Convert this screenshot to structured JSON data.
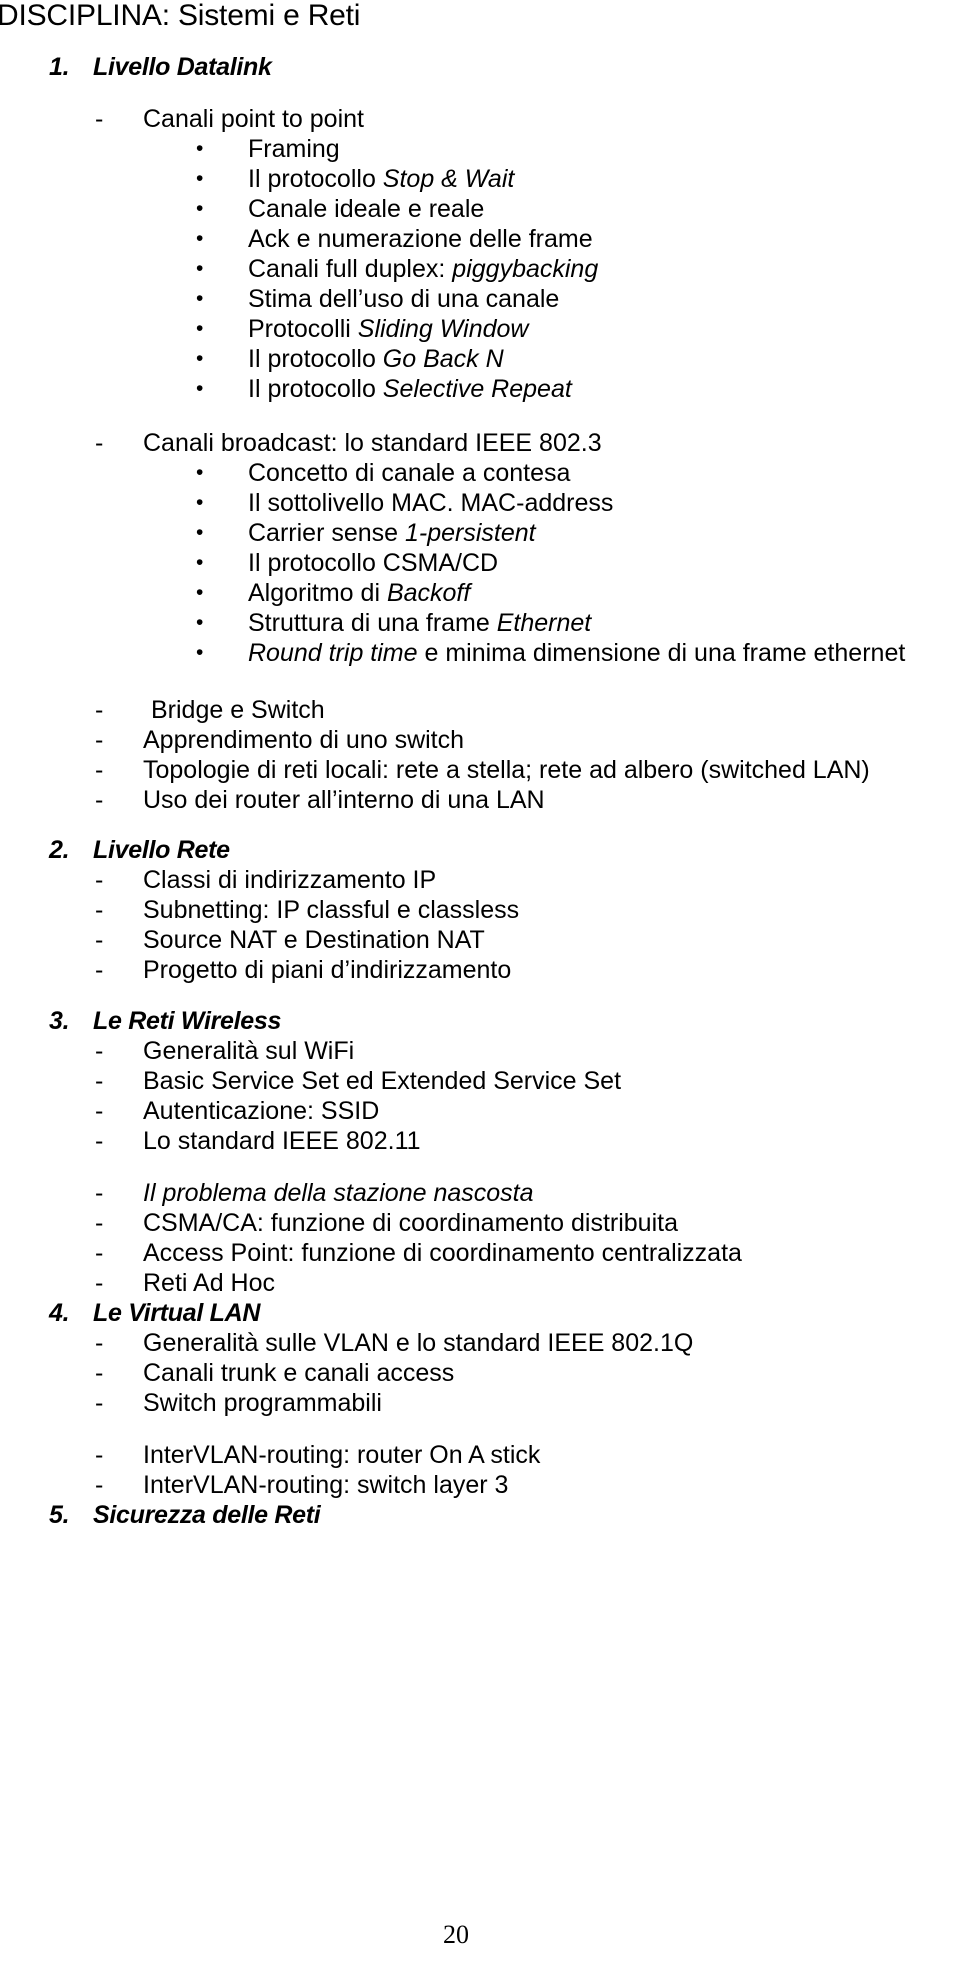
{
  "document": {
    "title": "DISCIPLINA: Sistemi e Reti",
    "page_number": "20",
    "bullet_glyph": "•",
    "dash_glyph": "-"
  },
  "sections": [
    {
      "number": "1.",
      "heading": "Livello Datalink",
      "items": [
        {
          "level": "dash",
          "text": "Canali point to point",
          "children": [
            {
              "level": "bullet",
              "text": "Framing"
            },
            {
              "level": "bullet",
              "pre": "Il protocollo ",
              "italic": "Stop & Wait",
              "post": ""
            },
            {
              "level": "bullet",
              "text": "Canale ideale e reale"
            },
            {
              "level": "bullet",
              "text": "Ack e numerazione delle frame"
            },
            {
              "level": "bullet",
              "pre": "Canali full duplex: ",
              "italic": "piggybacking",
              "post": ""
            },
            {
              "level": "bullet",
              "text": "Stima dell’uso di una canale"
            },
            {
              "level": "bullet",
              "pre": "Protocolli ",
              "italic": "Sliding Window",
              "post": ""
            },
            {
              "level": "bullet",
              "pre": "Il protocollo ",
              "italic": "Go Back N",
              "post": ""
            },
            {
              "level": "bullet",
              "pre": "Il protocollo ",
              "italic": "Selective Repeat",
              "post": ""
            }
          ]
        },
        {
          "level": "dash",
          "text": "Canali broadcast: lo standard IEEE 802.3",
          "children": [
            {
              "level": "bullet",
              "text": "Concetto di canale a contesa"
            },
            {
              "level": "bullet",
              "text": "Il sottolivello MAC.  MAC-address"
            },
            {
              "level": "bullet",
              "pre": "Carrier sense ",
              "italic": "1-persistent",
              "post": ""
            },
            {
              "level": "bullet",
              "text": "Il protocollo CSMA/CD"
            },
            {
              "level": "bullet",
              "pre": "Algoritmo di ",
              "italic": "Backoff",
              "post": ""
            },
            {
              "level": "bullet",
              "pre": "Struttura di una frame ",
              "italic": "Ethernet",
              "post": ""
            },
            {
              "level": "bullet",
              "pre": "",
              "italic": "Round trip time",
              "post": " e minima dimensione di una frame ethernet"
            }
          ]
        },
        {
          "level": "dash",
          "text": "Bridge e Switch",
          "extra_indent": true
        },
        {
          "level": "dash",
          "text": "Apprendimento di uno switch"
        },
        {
          "level": "dash",
          "text": "Topologie di reti locali: rete a stella; rete ad albero (switched LAN)"
        },
        {
          "level": "dash",
          "text": "Uso dei router all’interno di una LAN"
        }
      ]
    },
    {
      "number": "2.",
      "heading": "Livello Rete",
      "items": [
        {
          "level": "dash",
          "text": "Classi di indirizzamento IP"
        },
        {
          "level": "dash",
          "text": "Subnetting: IP classful e classless"
        },
        {
          "level": "dash",
          "text": "Source NAT e  Destination NAT"
        },
        {
          "level": "dash",
          "text": "Progetto di piani d’indirizzamento"
        }
      ]
    },
    {
      "number": "3.",
      "heading": "Le Reti Wireless",
      "items": [
        {
          "level": "dash",
          "text": "Generalità sul WiFi"
        },
        {
          "level": "dash",
          "text": "Basic Service Set ed Extended Service Set"
        },
        {
          "level": "dash",
          "text": "Autenticazione: SSID"
        },
        {
          "level": "dash",
          "text": "Lo standard IEEE 802.11"
        },
        {
          "level": "dash",
          "pre": "",
          "italic": "Il problema della stazione nascosta",
          "post": ""
        },
        {
          "level": "dash",
          "text": "CSMA/CA: funzione di coordinamento distribuita"
        },
        {
          "level": "dash",
          "text": "Access Point: funzione di coordinamento centralizzata"
        },
        {
          "level": "dash",
          "text": "Reti  Ad Hoc"
        }
      ]
    },
    {
      "number": "4.",
      "heading": "Le Virtual LAN",
      "items": [
        {
          "level": "dash",
          "text": "Generalità sulle VLAN e lo standard IEEE 802.1Q"
        },
        {
          "level": "dash",
          "text": "Canali trunk e canali access"
        },
        {
          "level": "dash",
          "text": "Switch programmabili"
        },
        {
          "level": "dash",
          "text": "InterVLAN-routing: router On A stick"
        },
        {
          "level": "dash",
          "text": "InterVLAN-routing: switch layer 3"
        }
      ]
    },
    {
      "number": "5.",
      "heading": "Sicurezza delle Reti",
      "items": []
    }
  ],
  "layout": {
    "line_tops": [
      52,
      104,
      134,
      164,
      194,
      224,
      254,
      284,
      314,
      344,
      374,
      428,
      458,
      488,
      518,
      548,
      578,
      608,
      638,
      695,
      725,
      755,
      785,
      835,
      865,
      895,
      925,
      955,
      1006,
      1036,
      1066,
      1096,
      1126,
      1178,
      1208,
      1238,
      1268,
      1298,
      1328,
      1358,
      1388,
      1440,
      1470,
      1500,
      1530,
      1560,
      1610
    ]
  }
}
